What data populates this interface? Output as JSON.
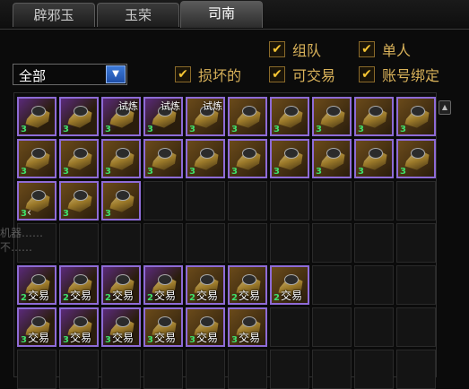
{
  "tabs": [
    {
      "label": "辟邪玉"
    },
    {
      "label": "玉荣"
    },
    {
      "label": "司南"
    }
  ],
  "active_tab": 2,
  "filters": {
    "team": {
      "label": "组队",
      "checked": true
    },
    "solo": {
      "label": "单人",
      "checked": true
    },
    "damaged": {
      "label": "损坏的",
      "checked": true
    },
    "tradable": {
      "label": "可交易",
      "checked": true
    },
    "account_bound": {
      "label": "账号绑定",
      "checked": true
    },
    "check_glyph": "✔"
  },
  "dropdown": {
    "value": "全部"
  },
  "overlay_text": {
    "line1": "机器……",
    "line2": "不……"
  },
  "items": [
    {
      "qty": "3",
      "tag": "",
      "trade": "",
      "style": "purple"
    },
    {
      "qty": "3",
      "tag": "",
      "trade": "",
      "style": "purple"
    },
    {
      "qty": "3",
      "tag": "试炼",
      "trade": "",
      "style": "purple"
    },
    {
      "qty": "3",
      "tag": "试炼",
      "trade": "",
      "style": "purple"
    },
    {
      "qty": "3",
      "tag": "试炼",
      "trade": "",
      "style": "gold"
    },
    {
      "qty": "3",
      "tag": "",
      "trade": "",
      "style": "gold"
    },
    {
      "qty": "3",
      "tag": "",
      "trade": "",
      "style": "gold"
    },
    {
      "qty": "3",
      "tag": "",
      "trade": "",
      "style": "gold"
    },
    {
      "qty": "3",
      "tag": "",
      "trade": "",
      "style": "gold"
    },
    {
      "qty": "3",
      "tag": "",
      "trade": "",
      "style": "gold"
    },
    {
      "qty": "3",
      "tag": "",
      "trade": "",
      "style": "gold"
    },
    {
      "qty": "3",
      "tag": "",
      "trade": "",
      "style": "gold"
    },
    {
      "qty": "3",
      "tag": "",
      "trade": "",
      "style": "gold"
    },
    {
      "qty": "3",
      "tag": "",
      "trade": "",
      "style": "gold"
    },
    {
      "qty": "3",
      "tag": "",
      "trade": "",
      "style": "gold"
    },
    {
      "qty": "3",
      "tag": "",
      "trade": "",
      "style": "gold"
    },
    {
      "qty": "3",
      "tag": "",
      "trade": "",
      "style": "gold"
    },
    {
      "qty": "3",
      "tag": "",
      "trade": "",
      "style": "gold"
    },
    {
      "qty": "3",
      "tag": "",
      "trade": "",
      "style": "gold"
    },
    {
      "qty": "3",
      "tag": "",
      "trade": "",
      "style": "gold"
    },
    {
      "qty": "3",
      "tag": "",
      "trade": "",
      "style": "gold"
    },
    {
      "qty": "3",
      "tag": "",
      "trade": "",
      "style": "gold"
    },
    {
      "qty": "3",
      "tag": "",
      "trade": "",
      "style": "gold"
    },
    {
      "qty": "2",
      "tag": "",
      "trade": "交易",
      "style": "purple"
    },
    {
      "qty": "2",
      "tag": "",
      "trade": "交易",
      "style": "purple"
    },
    {
      "qty": "2",
      "tag": "",
      "trade": "交易",
      "style": "purple"
    },
    {
      "qty": "2",
      "tag": "",
      "trade": "交易",
      "style": "purple"
    },
    {
      "qty": "2",
      "tag": "",
      "trade": "交易",
      "style": "gold"
    },
    {
      "qty": "2",
      "tag": "",
      "trade": "交易",
      "style": "gold"
    },
    {
      "qty": "2",
      "tag": "",
      "trade": "交易",
      "style": "gold"
    },
    {
      "qty": "3",
      "tag": "",
      "trade": "交易",
      "style": "purple"
    },
    {
      "qty": "3",
      "tag": "",
      "trade": "交易",
      "style": "purple"
    },
    {
      "qty": "3",
      "tag": "",
      "trade": "交易",
      "style": "purple"
    },
    {
      "qty": "3",
      "tag": "",
      "trade": "交易",
      "style": "gold"
    },
    {
      "qty": "3",
      "tag": "",
      "trade": "交易",
      "style": "gold"
    },
    {
      "qty": "3",
      "tag": "",
      "trade": "交易",
      "style": "gold"
    }
  ],
  "item_positions": [
    [
      0,
      0
    ],
    [
      1,
      0
    ],
    [
      2,
      0
    ],
    [
      3,
      0
    ],
    [
      4,
      0
    ],
    [
      5,
      0
    ],
    [
      6,
      0
    ],
    [
      7,
      0
    ],
    [
      8,
      0
    ],
    [
      9,
      0
    ],
    [
      0,
      1
    ],
    [
      1,
      1
    ],
    [
      2,
      1
    ],
    [
      3,
      1
    ],
    [
      4,
      1
    ],
    [
      5,
      1
    ],
    [
      6,
      1
    ],
    [
      7,
      1
    ],
    [
      8,
      1
    ],
    [
      9,
      1
    ],
    [
      0,
      2
    ],
    [
      1,
      2
    ],
    [
      2,
      2
    ],
    [
      0,
      4
    ],
    [
      1,
      4
    ],
    [
      2,
      4
    ],
    [
      3,
      4
    ],
    [
      4,
      4
    ],
    [
      5,
      4
    ],
    [
      6,
      4
    ],
    [
      0,
      5
    ],
    [
      1,
      5
    ],
    [
      2,
      5
    ],
    [
      3,
      5
    ],
    [
      4,
      5
    ],
    [
      5,
      5
    ]
  ]
}
